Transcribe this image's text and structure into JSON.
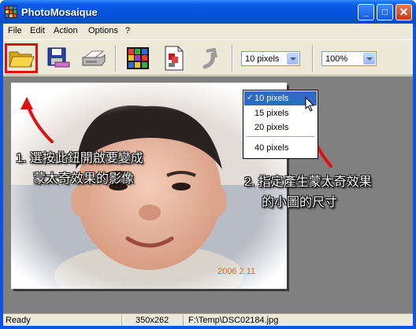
{
  "window": {
    "title": "PhotoMosaique",
    "controls": {
      "minimize": "_",
      "maximize": "□",
      "close": "✕"
    }
  },
  "menu": {
    "items": [
      {
        "label": "File",
        "key": "F"
      },
      {
        "label": "Edit",
        "key": "E"
      },
      {
        "label": "Action",
        "key": "A"
      },
      {
        "label": "Options",
        "key": "O"
      },
      {
        "label": "?",
        "key": ""
      }
    ]
  },
  "toolbar": {
    "buttons": [
      {
        "name": "open-folder-icon"
      },
      {
        "name": "save-icon"
      },
      {
        "name": "print-icon"
      },
      {
        "name": "mosaic-palette-icon"
      },
      {
        "name": "pdf-document-icon"
      },
      {
        "name": "undo-icon"
      }
    ],
    "tile_size": {
      "value": "10 pixels"
    },
    "zoom": {
      "value": "100%"
    }
  },
  "dropdown": {
    "options": [
      "10 pixels",
      "15 pixels",
      "20 pixels",
      "40 pixels"
    ],
    "selected": "10 pixels",
    "check_glyph": "✓"
  },
  "photo": {
    "date_stamp": "2006 2 11"
  },
  "annotations": {
    "step1": [
      "1. 選按此鈕開啟要變成",
      "蒙太奇效果的影像"
    ],
    "step2": [
      "2. 指定產生蒙太奇效果",
      "的小圖的尺寸"
    ]
  },
  "statusbar": {
    "status": "Ready",
    "dimensions": "350x262",
    "path": "F:\\Temp\\DSC02184.jpg"
  },
  "colors": {
    "titlebar": "#0553dc",
    "chrome": "#ece9d8",
    "canvas": "#808080",
    "highlight": "#316ac5",
    "annotation_arrow": "#e01010"
  }
}
